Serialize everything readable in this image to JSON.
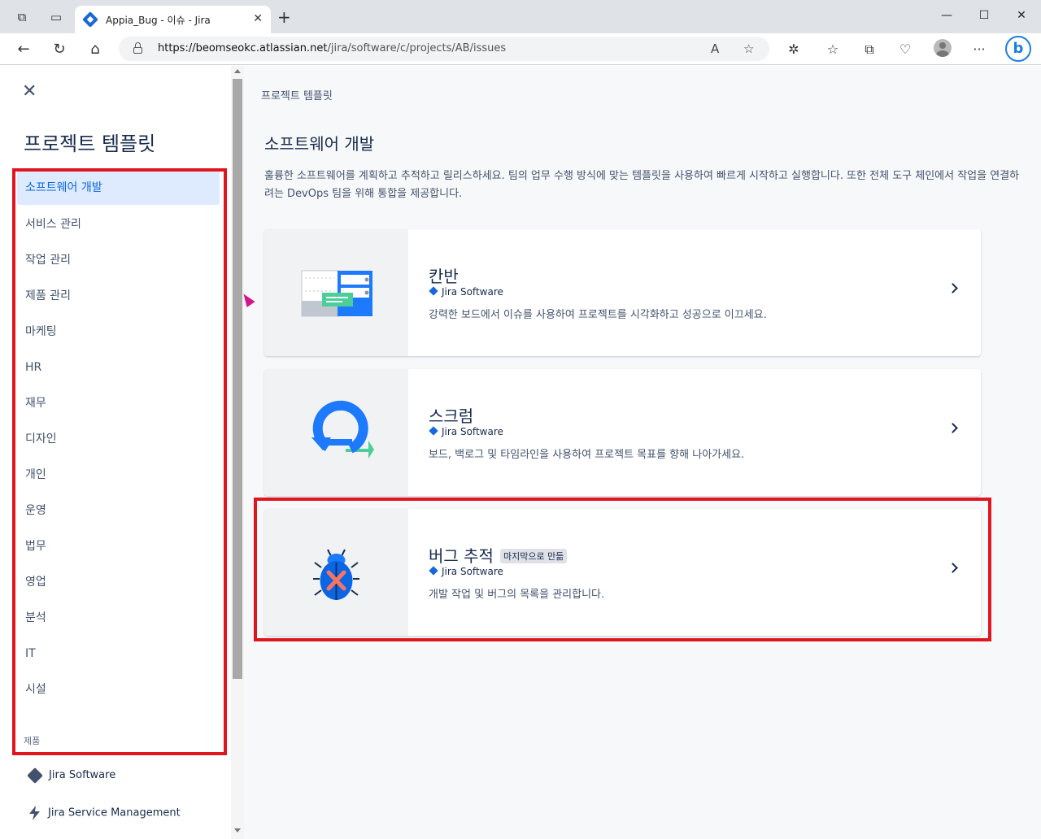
{
  "browser": {
    "tab_title": "Appia_Bug - 이슈 - Jira",
    "url_host": "https://beomseokc.atlassian.net",
    "url_path": "/jira/software/c/projects/AB/issues"
  },
  "sidebar": {
    "title": "프로젝트 템플릿",
    "categories": [
      {
        "label": "소프트웨어 개발",
        "active": true
      },
      {
        "label": "서비스 관리"
      },
      {
        "label": "작업 관리"
      },
      {
        "label": "제품 관리"
      },
      {
        "label": "마케팅"
      },
      {
        "label": "HR"
      },
      {
        "label": "재무"
      },
      {
        "label": "디자인"
      },
      {
        "label": "개인"
      },
      {
        "label": "운영"
      },
      {
        "label": "법무"
      },
      {
        "label": "영업"
      },
      {
        "label": "분석"
      },
      {
        "label": "IT"
      },
      {
        "label": "시설"
      }
    ],
    "products_label": "제품",
    "products": [
      {
        "label": "Jira Software"
      },
      {
        "label": "Jira Service Management"
      }
    ]
  },
  "main": {
    "breadcrumb": "프로젝트 템플릿",
    "title": "소프트웨어 개발",
    "description": "훌륭한 소프트웨어를 계획하고 추적하고 릴리스하세요. 팀의 업무 수행 방식에 맞는 템플릿을 사용하여 빠르게 시작하고 실행합니다. 또한 전체 도구 체인에서 작업을 연결하려는 DevOps 팀을 위해 통합을 제공합니다.",
    "templates": [
      {
        "name": "칸반",
        "product": "Jira Software",
        "description": "강력한 보드에서 이슈를 사용하여 프로젝트를 시각화하고 성공으로 이끄세요.",
        "badge": ""
      },
      {
        "name": "스크럼",
        "product": "Jira Software",
        "description": "보드, 백로그 및 타임라인을 사용하여 프로젝트 목표를 향해 나아가세요.",
        "badge": ""
      },
      {
        "name": "버그 추적",
        "product": "Jira Software",
        "description": "개발 작업 및 버그의 목록을 관리합니다.",
        "badge": "마지막으로 만듦"
      }
    ]
  }
}
